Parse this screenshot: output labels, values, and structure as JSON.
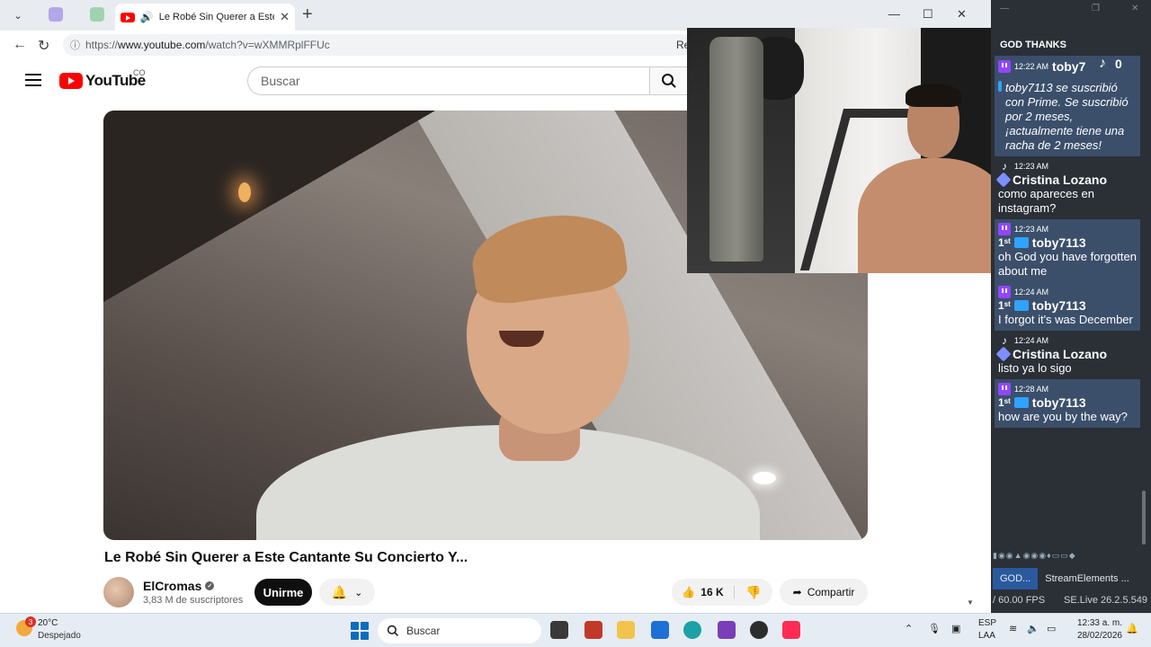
{
  "browser": {
    "active_tab_title": "Le Robé Sin Querer a Este Cantante Su Concierto Y...",
    "url_prefix": "https://",
    "url_host": "www.youtube.com",
    "url_path": "/watch?v=wXMMRplFFUc",
    "reader_label": "Re"
  },
  "youtube": {
    "logo_text": "YouTube",
    "country_code": "CO",
    "search_placeholder": "Buscar",
    "video_title": "Le Robé Sin Querer a Este Cantante Su Concierto Y...",
    "channel_name": "ElCromas",
    "subscribers": "3,83 M de suscriptores",
    "join_label": "Unirme",
    "like_count": "16 K",
    "share_label": "Compartir"
  },
  "chat": {
    "header": "GOD THANKS",
    "tiktok_counter": "0",
    "messages": [
      {
        "platform": "twitch",
        "time": "12:22 AM",
        "user": "toby7",
        "badges": [],
        "text": "",
        "highlight": true
      },
      {
        "platform": "twitch",
        "time": "",
        "user": "",
        "badges": [
          "crown"
        ],
        "text": "toby7113 se suscribió con Prime. Se suscribió por 2 meses, ¡actualmente tiene una racha de 2 meses!",
        "highlight": true
      },
      {
        "platform": "tiktok",
        "time": "12:23 AM",
        "user": "Cristina Lozano",
        "badges": [
          "diamond"
        ],
        "text": "como apareces en instagram?",
        "highlight": false
      },
      {
        "platform": "twitch",
        "time": "12:23 AM",
        "user": "toby7113",
        "badges": [
          "1st",
          "crown"
        ],
        "text": "oh God you have forgotten about me",
        "highlight": true
      },
      {
        "platform": "twitch",
        "time": "12:24 AM",
        "user": "toby7113",
        "badges": [
          "1st",
          "crown"
        ],
        "text": "I forgot it's was December",
        "highlight": true
      },
      {
        "platform": "tiktok",
        "time": "12:24 AM",
        "user": "Cristina Lozano",
        "badges": [
          "diamond"
        ],
        "text": "listo ya lo sigo",
        "highlight": false
      },
      {
        "platform": "twitch",
        "time": "12:28 AM",
        "user": "toby7113",
        "badges": [
          "1st",
          "crown"
        ],
        "text": "how are you by the way?",
        "highlight": true
      }
    ],
    "tab_god": "GOD...",
    "tab_streamelements": "StreamElements ...",
    "fps": "/ 60.00 FPS",
    "se_version": "SE.Live 26.2.5.549"
  },
  "taskbar": {
    "weather_badge": "3",
    "temperature": "20°C",
    "weather_desc": "Despejado",
    "search_label": "Buscar",
    "lang": "ESP",
    "region": "LAA",
    "time": "12:33 a. m.",
    "date": "28/02/2026"
  },
  "colors": {
    "twitch": "#9146ff",
    "youtube_red": "#ff0000",
    "chat_highlight": "#3b4f6a",
    "sidebar_bg": "#2b2f36"
  }
}
